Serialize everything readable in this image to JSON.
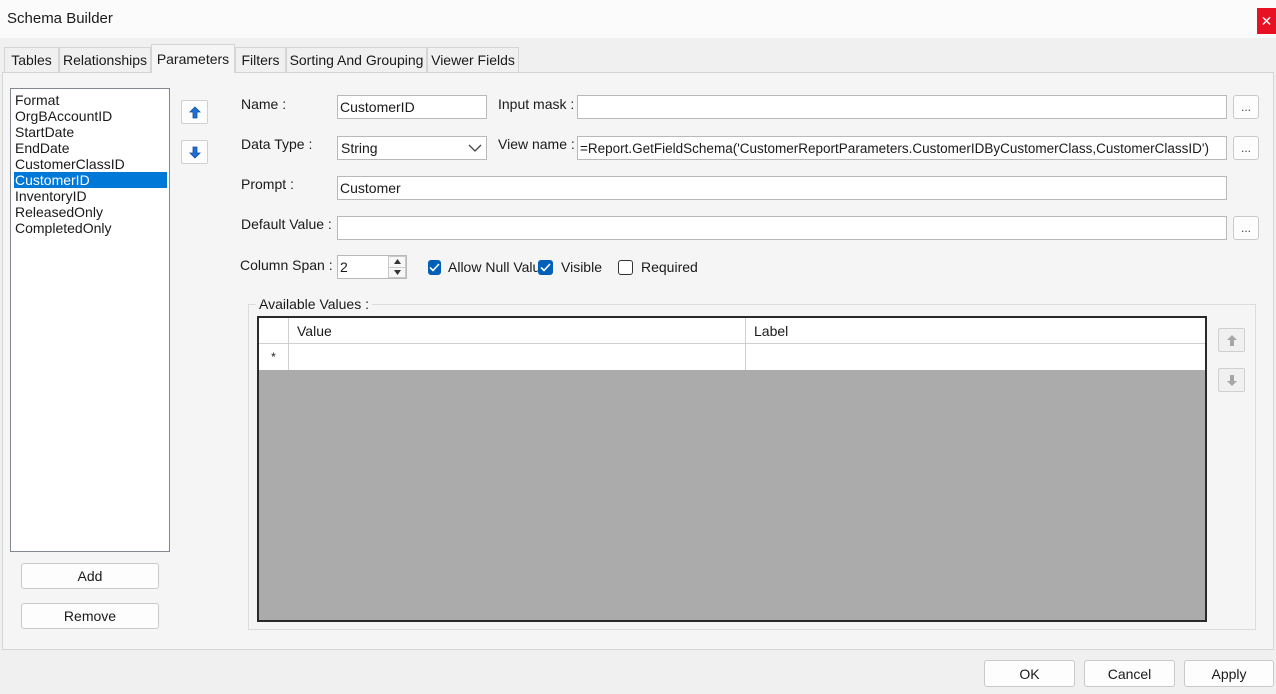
{
  "window": {
    "title": "Schema Builder",
    "close_glyph": "✕"
  },
  "tabs": [
    {
      "label": "Tables",
      "active": false
    },
    {
      "label": "Relationships",
      "active": false
    },
    {
      "label": "Parameters",
      "active": true
    },
    {
      "label": "Filters",
      "active": false
    },
    {
      "label": "Sorting And Grouping",
      "active": false
    },
    {
      "label": "Viewer Fields",
      "active": false
    }
  ],
  "parameters_list": {
    "items": [
      "Format",
      "OrgBAccountID",
      "StartDate",
      "EndDate",
      "CustomerClassID",
      "CustomerID",
      "InventoryID",
      "ReleasedOnly",
      "CompletedOnly"
    ],
    "selected_index": 5
  },
  "list_buttons": {
    "add": "Add",
    "remove": "Remove"
  },
  "form": {
    "name_label": "Name :",
    "name_value": "CustomerID",
    "input_mask_label": "Input mask :",
    "input_mask_value": "",
    "data_type_label": "Data Type :",
    "data_type_value": "String",
    "view_name_label": "View name :",
    "view_name_value": "=Report.GetFieldSchema('CustomerReportParameters.CustomerIDByCustomerClass,CustomerClassID')",
    "prompt_label": "Prompt :",
    "prompt_value": "Customer",
    "default_value_label": "Default Value :",
    "default_value_value": "",
    "column_span_label": "Column Span :",
    "column_span_value": "2",
    "ellipsis": "...",
    "allow_null_label": "Allow Null Value",
    "allow_null_checked": true,
    "visible_label": "Visible",
    "visible_checked": true,
    "required_label": "Required",
    "required_checked": false
  },
  "available_values": {
    "group_title": "Available Values :",
    "columns": [
      "Value",
      "Label"
    ],
    "new_row_marker": "*"
  },
  "footer": {
    "ok": "OK",
    "cancel": "Cancel",
    "apply": "Apply"
  },
  "colors": {
    "accent": "#0078d7",
    "checkbox": "#005fb8",
    "close": "#e81123",
    "grid_bg": "#ababab"
  }
}
